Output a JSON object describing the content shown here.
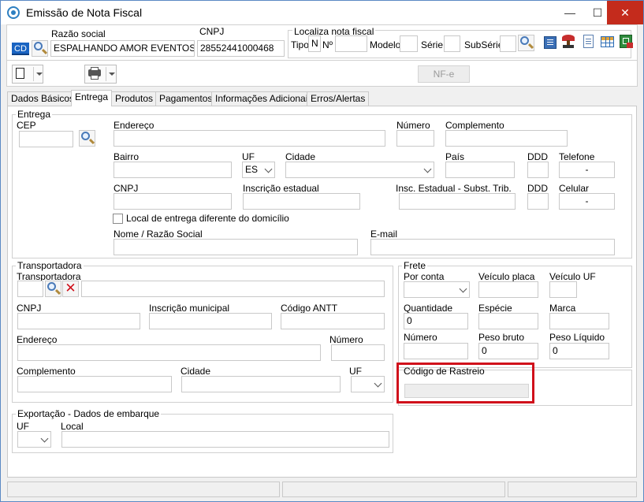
{
  "window": {
    "title": "Emissão de Nota Fiscal",
    "minimize": "—",
    "maximize": "☐",
    "close": "✕"
  },
  "header": {
    "cd_label": "CD",
    "razao_label": "Razão social",
    "razao_value": "ESPALHANDO AMOR EVENTOS E FRA",
    "cnpj_label": "CNPJ",
    "cnpj_value": "28552441000468",
    "localiza_label": "Localiza nota fiscal",
    "tipo_label": "Tipo",
    "tipo_value": "N",
    "numero_label": "Nº",
    "modelo_label": "Modelo",
    "serie_label": "Série",
    "subserie_label": "SubSérie"
  },
  "toolbar": {
    "nfe_label": "NF-e"
  },
  "tabs": [
    "Dados Básicos",
    "Entrega",
    "Produtos",
    "Pagamentos",
    "Informações Adicionais",
    "Erros/Alertas"
  ],
  "entrega": {
    "title": "Entrega",
    "cep": "CEP",
    "endereco": "Endereço",
    "numero": "Número",
    "complemento": "Complemento",
    "bairro": "Bairro",
    "uf": "UF",
    "uf_value": "ES",
    "cidade": "Cidade",
    "pais": "País",
    "ddd": "DDD",
    "telefone": "Telefone",
    "telefone_value": "-",
    "cnpj": "CNPJ",
    "ie": "Inscrição estadual",
    "ie_st": "Insc. Estadual - Subst. Trib.",
    "ddd2": "DDD",
    "celular": "Celular",
    "celular_value": "-",
    "local_diferente": "Local de entrega diferente do domicílio",
    "nome": "Nome / Razão Social",
    "email": "E-mail"
  },
  "transportadora": {
    "title": "Transportadora",
    "transportadora": "Transportadora",
    "cnpj": "CNPJ",
    "im": "Inscrição municipal",
    "antt": "Código ANTT",
    "endereco": "Endereço",
    "numero": "Número",
    "complemento": "Complemento",
    "cidade": "Cidade",
    "uf": "UF"
  },
  "frete": {
    "title": "Frete",
    "por_conta": "Por conta",
    "veiculo_placa": "Veículo placa",
    "veiculo_uf": "Veículo UF",
    "quantidade": "Quantidade",
    "quantidade_value": "0",
    "especie": "Espécie",
    "marca": "Marca",
    "numero": "Número",
    "peso_bruto": "Peso bruto",
    "peso_bruto_value": "0",
    "peso_liquido": "Peso Líquido",
    "peso_liquido_value": "0",
    "rastreio": "Código de Rastreio"
  },
  "exportacao": {
    "title": "Exportação - Dados de embarque",
    "uf": "UF",
    "local": "Local"
  },
  "colors": {
    "highlight": "#d0101b",
    "accent": "#2d7fc1"
  }
}
